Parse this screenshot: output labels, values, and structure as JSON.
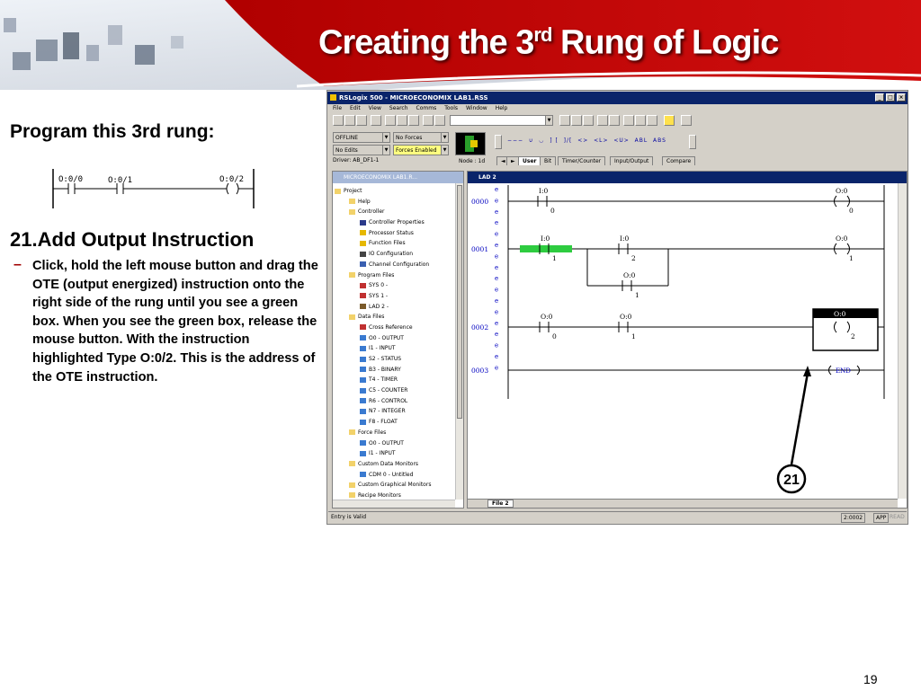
{
  "slide": {
    "title_main": "Creating the 3",
    "title_sup": "rd",
    "title_rest": " Rung of Logic",
    "program_label": "Program this 3rd rung:",
    "step_heading": "21.Add Output Instruction",
    "bullet_dash": "–",
    "step_text": "Click, hold the left mouse button and drag the OTE (output energized) instruction onto the right side of the rung until you see a green box.  When you see the green box, release the mouse button. With the instruction highlighted Type O:0/2. This is the address of the OTE instruction.",
    "page_number": "19",
    "callout_number": "21",
    "mini_rung": {
      "contact1": "O:0/0",
      "contact2": "O:0/1",
      "coil": "O:0/2"
    }
  },
  "window": {
    "title": "RSLogix 500 - MICROECONOMIX LAB1.RSS",
    "title_buttons": [
      "_",
      "□",
      "×"
    ],
    "menu": [
      "File",
      "Edit",
      "View",
      "Search",
      "Comms",
      "Tools",
      "Window",
      "Help"
    ],
    "mode_value": "OFFLINE",
    "forces_value": "No Forces",
    "edits_value": "No Edits",
    "forces_enabled_value": "Forces Enabled",
    "driver_label": "Driver: AB_DF1-1",
    "node_label": "Node : 1d",
    "instr_tabs": [
      "User",
      "Bit",
      "Timer/Counter",
      "Input/Output",
      "Compare"
    ],
    "instr_icons": [
      "−−−",
      "∪",
      "◡",
      "] [",
      "]/[",
      "<>",
      "<L>",
      "<U>",
      "ABL",
      "ABS"
    ],
    "status_left": "Entry is Valid",
    "status_addr": "2:0002",
    "status_app": "APP",
    "status_read": "READ"
  },
  "project_tree": {
    "caption": "MICROECONOMIX LAB1.R...",
    "items": [
      {
        "label": "Project",
        "indent": 0,
        "icon": "folder-icon"
      },
      {
        "label": "Help",
        "indent": 1,
        "icon": "folder-icon"
      },
      {
        "label": "Controller",
        "indent": 1,
        "icon": "folder-icon"
      },
      {
        "label": "Controller Properties",
        "indent": 2,
        "icon": "properties-icon"
      },
      {
        "label": "Processor Status",
        "indent": 2,
        "icon": "status-icon"
      },
      {
        "label": "Function Files",
        "indent": 2,
        "icon": "function-icon"
      },
      {
        "label": "IO Configuration",
        "indent": 2,
        "icon": "io-icon"
      },
      {
        "label": "Channel Configuration",
        "indent": 2,
        "icon": "channel-icon"
      },
      {
        "label": "Program Files",
        "indent": 1,
        "icon": "folder-icon"
      },
      {
        "label": "SYS 0 -",
        "indent": 2,
        "icon": "sys-file-icon"
      },
      {
        "label": "SYS 1 -",
        "indent": 2,
        "icon": "sys-file-icon"
      },
      {
        "label": "LAD 2 -",
        "indent": 2,
        "icon": "ladder-file-icon"
      },
      {
        "label": "Data Files",
        "indent": 1,
        "icon": "folder-icon"
      },
      {
        "label": "Cross Reference",
        "indent": 2,
        "icon": "xref-icon"
      },
      {
        "label": "O0 - OUTPUT",
        "indent": 2,
        "icon": "data-file-icon"
      },
      {
        "label": "I1 - INPUT",
        "indent": 2,
        "icon": "data-file-icon"
      },
      {
        "label": "S2 - STATUS",
        "indent": 2,
        "icon": "data-file-icon"
      },
      {
        "label": "B3 - BINARY",
        "indent": 2,
        "icon": "data-file-icon"
      },
      {
        "label": "T4 - TIMER",
        "indent": 2,
        "icon": "data-file-icon"
      },
      {
        "label": "C5 - COUNTER",
        "indent": 2,
        "icon": "data-file-icon"
      },
      {
        "label": "R6 - CONTROL",
        "indent": 2,
        "icon": "data-file-icon"
      },
      {
        "label": "N7 - INTEGER",
        "indent": 2,
        "icon": "data-file-icon"
      },
      {
        "label": "F8 - FLOAT",
        "indent": 2,
        "icon": "data-file-icon"
      },
      {
        "label": "Force Files",
        "indent": 1,
        "icon": "folder-icon"
      },
      {
        "label": "O0 - OUTPUT",
        "indent": 2,
        "icon": "data-file-icon"
      },
      {
        "label": "I1 - INPUT",
        "indent": 2,
        "icon": "data-file-icon"
      },
      {
        "label": "Custom Data Monitors",
        "indent": 1,
        "icon": "folder-icon"
      },
      {
        "label": "CDM 0 - Untitled",
        "indent": 2,
        "icon": "monitor-icon"
      },
      {
        "label": "Custom Graphical Monitors",
        "indent": 1,
        "icon": "folder-icon"
      },
      {
        "label": "Recipe Monitors",
        "indent": 1,
        "icon": "folder-icon"
      }
    ]
  },
  "ladder": {
    "caption": "LAD 2",
    "file_tab": "File 2",
    "rungs": [
      {
        "number": "0000",
        "contacts": [
          {
            "addr": "I:0",
            "bit": "0"
          }
        ],
        "coil": {
          "addr": "O:0",
          "bit": "0"
        }
      },
      {
        "number": "0001",
        "contacts": [
          {
            "addr": "I:0",
            "bit": "1"
          },
          {
            "addr": "I:0",
            "bit": "2"
          }
        ],
        "branch": {
          "addr": "O:0",
          "bit": "1"
        },
        "coil": {
          "addr": "O:0",
          "bit": "1"
        }
      },
      {
        "number": "0002",
        "contacts": [
          {
            "addr": "O:0",
            "bit": "0"
          },
          {
            "addr": "O:0",
            "bit": "1"
          }
        ],
        "coil": {
          "addr": "O:0",
          "bit": "2"
        }
      },
      {
        "number": "0003",
        "end": "END"
      }
    ],
    "e_markers": [
      "e",
      "e",
      "e",
      "e",
      "e",
      "e",
      "e",
      "e",
      "e",
      "e",
      "e",
      "e",
      "e",
      "e",
      "e",
      "e",
      "e"
    ]
  }
}
